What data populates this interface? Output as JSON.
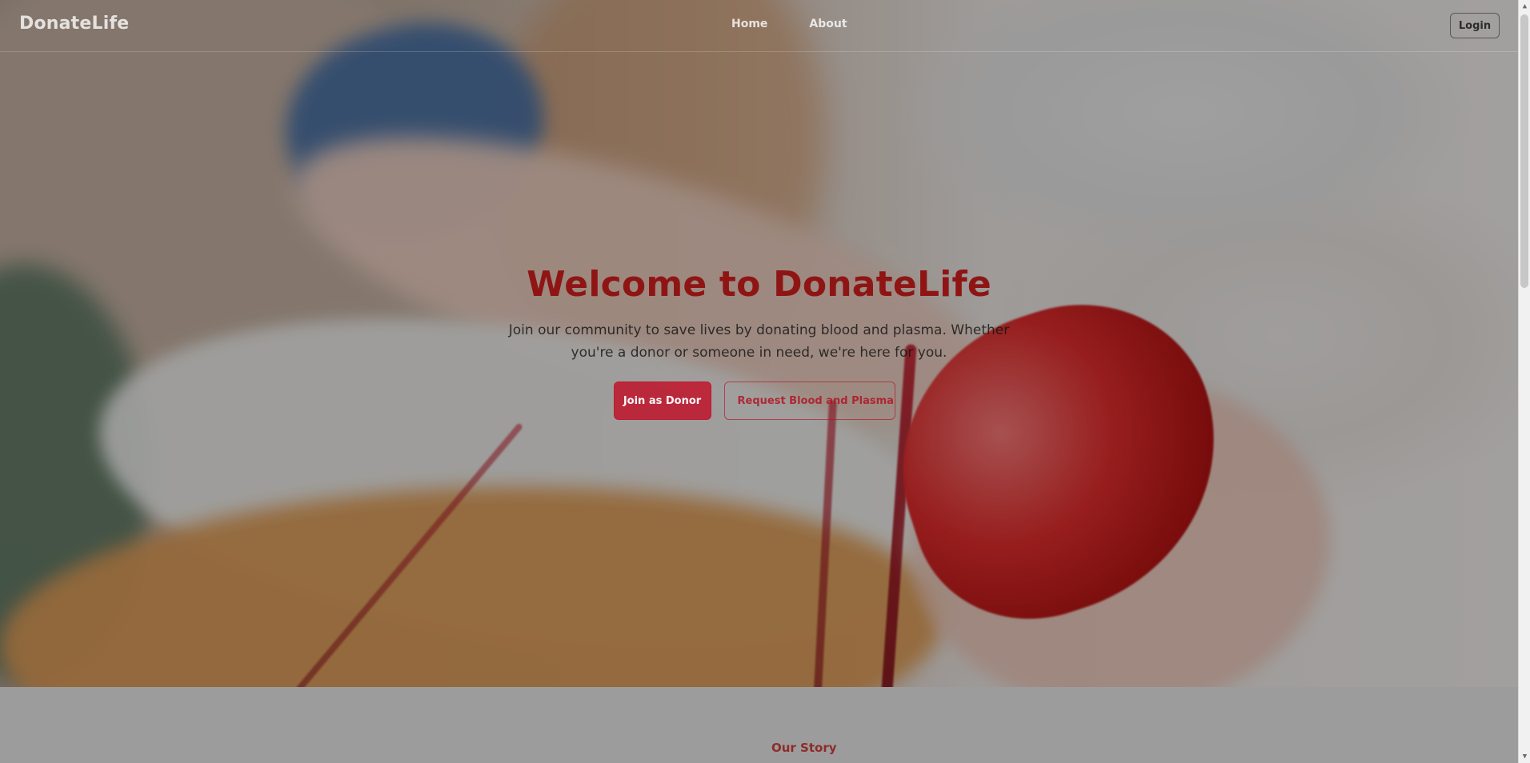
{
  "nav": {
    "brand": "DonateLife",
    "links": [
      "Home",
      "About"
    ],
    "login": "Login"
  },
  "hero": {
    "title": "Welcome to DonateLife",
    "subtitle": "Join our community to save lives by donating blood and plasma. Whether you're a donor or someone in need, we're here for you.",
    "primary_cta": "Join as Donor",
    "secondary_cta": "Request Blood and Plasma"
  },
  "lower": {
    "section_label": "Our Story"
  },
  "icons": {
    "scroll_up": "triangle-up-icon",
    "scroll_down": "triangle-down-icon"
  }
}
